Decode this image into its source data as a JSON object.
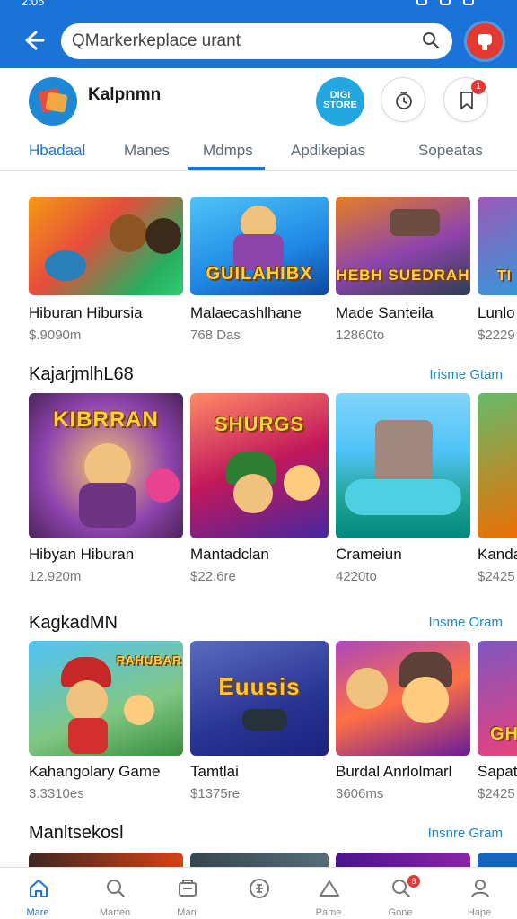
{
  "status_bar": {
    "time": "2:05"
  },
  "search": {
    "placeholder": "QMarkerkeplace urant"
  },
  "app": {
    "name": "Kalpnmn",
    "store_badge": "DIGI STORE"
  },
  "header_badges": {
    "notifications": "1"
  },
  "tabs": [
    {
      "label": "Hbadaal",
      "active": true
    },
    {
      "label": "Manes"
    },
    {
      "label": "Mdmps"
    },
    {
      "label": "Apdikepias"
    },
    {
      "label": "Sopeatas"
    }
  ],
  "rows": [
    {
      "title": "",
      "link": "",
      "cards": [
        {
          "title": "Hiburan Hibursia",
          "sub": "$.9090m",
          "caption": ""
        },
        {
          "title": "Malaecashlhane",
          "sub": "768 Das",
          "caption": "GUILAHIBX"
        },
        {
          "title": "Made Santeila",
          "sub": "12860to",
          "caption": "HEBH SUEDRAH"
        },
        {
          "title": "Lunlo",
          "sub": "$2229",
          "caption": "TI"
        }
      ]
    },
    {
      "title": "KajarjmlhL68",
      "link": "Irisme Gtam",
      "cards": [
        {
          "title": "Hibyan Hiburan",
          "sub": "12.920m",
          "caption": "KIBRRAN"
        },
        {
          "title": "Mantadclan",
          "sub": "$22.6re",
          "caption": "SHURGS"
        },
        {
          "title": "Crameiun",
          "sub": "4220to",
          "caption": ""
        },
        {
          "title": "Kanda",
          "sub": "$2425",
          "caption": ""
        }
      ]
    },
    {
      "title": "KagkadMN",
      "link": "Insme Oram",
      "cards": [
        {
          "title": "Kahangolary Game",
          "sub": "3.3310es",
          "caption": "RAHUBAR"
        },
        {
          "title": "Tamtlai",
          "sub": "$1375re",
          "caption": "Euusis"
        },
        {
          "title": "Burdal Anrlolmarl",
          "sub": "3606ms",
          "caption": ""
        },
        {
          "title": "Sapat",
          "sub": "$2425",
          "caption": "GH"
        }
      ]
    },
    {
      "title": "Manltsekosl",
      "link": "Insnre Gram",
      "cards": []
    }
  ],
  "bottom_nav": [
    {
      "label": "Mare",
      "icon": "home-icon",
      "active": true
    },
    {
      "label": "Marten",
      "icon": "search-icon"
    },
    {
      "label": "Man",
      "icon": "wallet-icon"
    },
    {
      "label": "",
      "icon": "compass-icon"
    },
    {
      "label": "Pame",
      "icon": "tent-icon"
    },
    {
      "label": "Gone",
      "icon": "search-badge-icon",
      "badge": "8"
    },
    {
      "label": "Hape",
      "icon": "person-icon"
    }
  ]
}
